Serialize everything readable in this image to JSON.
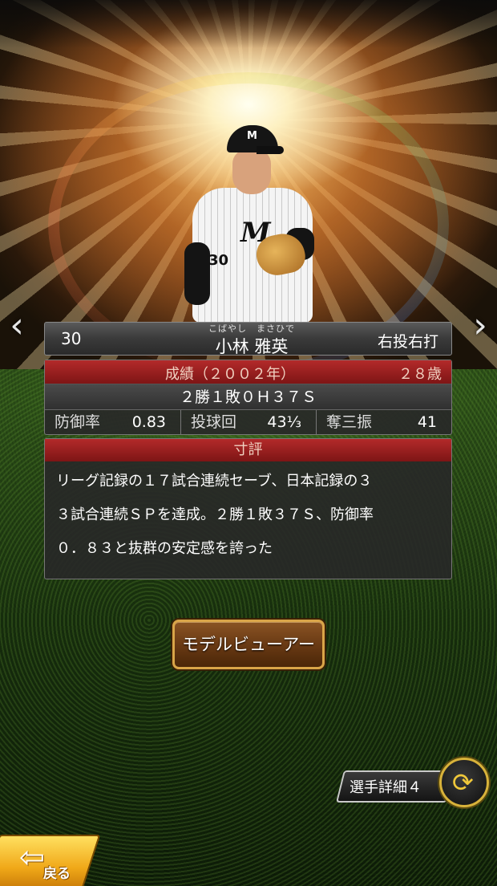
{
  "player": {
    "number": "30",
    "name_ruby": "こばやし　まさひで",
    "name": "小林 雅英",
    "throw_bat": "右投右打",
    "cap_logo": "M",
    "jersey_logo": "M",
    "jersey_number": "30"
  },
  "stats": {
    "header": "成績（２００２年）",
    "age": "２８歳",
    "record": "２勝１敗０Ｈ３７Ｓ",
    "items": [
      {
        "label": "防御率",
        "value": "0.83"
      },
      {
        "label": "投球回",
        "value": "43⅓"
      },
      {
        "label": "奪三振",
        "value": "41"
      }
    ]
  },
  "comment": {
    "header": "寸評",
    "lines": [
      "リーグ記録の１７試合連続セーブ、日本記録の３",
      "３試合連続ＳＰを達成。２勝１敗３７Ｓ、防御率",
      "０．８３と抜群の安定感を誇った"
    ]
  },
  "buttons": {
    "model_viewer": "モデルビューアー",
    "player_detail": "選手詳細４",
    "back": "戻る"
  },
  "icons": {
    "nav_prev": "‹",
    "nav_next": "›",
    "cycle": "⟳",
    "back_arrow": "⇦"
  },
  "colors": {
    "header_red": "#b32a2a",
    "button_gold": "#d9a548",
    "back_yellow": "#f0a818"
  }
}
